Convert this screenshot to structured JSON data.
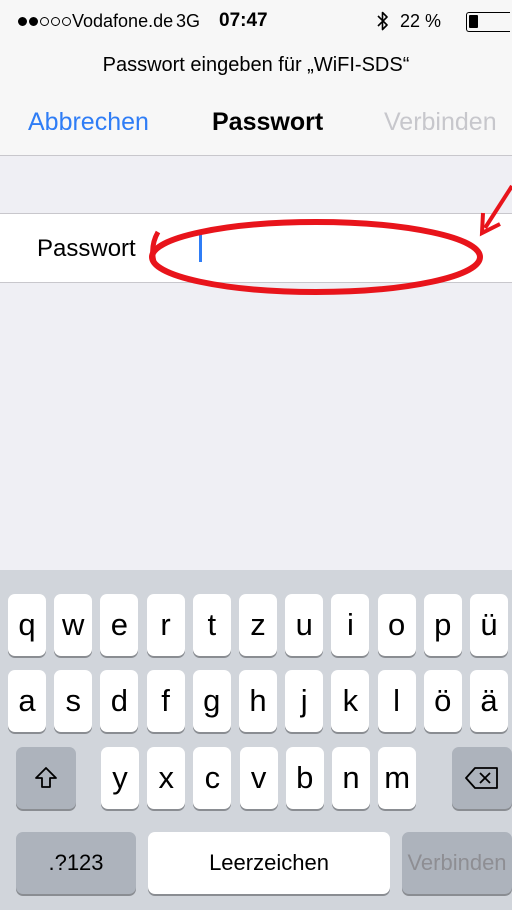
{
  "status_bar": {
    "carrier": "Vodafone.de",
    "network": "3G",
    "time": "07:47",
    "battery_percent": "22 %",
    "battery_level": 0.22,
    "signal_bars_filled": 2,
    "signal_bars_total": 5,
    "icons": [
      "signal-dots-icon",
      "bluetooth-icon",
      "battery-icon"
    ]
  },
  "prompt": {
    "text": "Passwort eingeben für „WiFI-SDS“"
  },
  "nav": {
    "cancel_label": "Abbrechen",
    "title": "Passwort",
    "connect_label": "Verbinden"
  },
  "form": {
    "password_label": "Passwort",
    "password_value": "",
    "password_placeholder": ""
  },
  "annotation": {
    "color": "#e8141b"
  },
  "keyboard": {
    "row1": [
      "q",
      "w",
      "e",
      "r",
      "t",
      "z",
      "u",
      "i",
      "o",
      "p",
      "ü"
    ],
    "row2": [
      "a",
      "s",
      "d",
      "f",
      "g",
      "h",
      "j",
      "k",
      "l",
      "ö",
      "ä"
    ],
    "row3": [
      "y",
      "x",
      "c",
      "v",
      "b",
      "n",
      "m"
    ],
    "numbers_label": ".?123",
    "space_label": "Leerzeichen",
    "return_label": "Verbinden",
    "shift_icon": "shift-icon",
    "delete_icon": "delete-icon"
  },
  "colors": {
    "accent": "#2f7df6",
    "disabled": "#c7c7cc",
    "annotation": "#e8141b"
  }
}
